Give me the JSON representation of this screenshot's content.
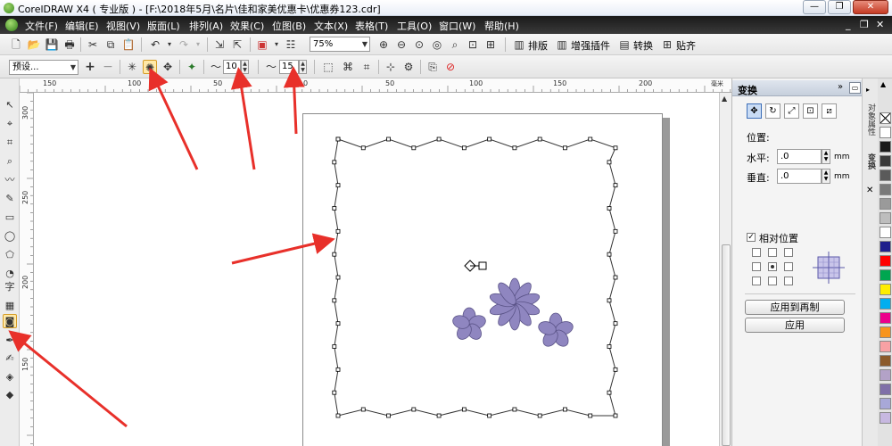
{
  "window": {
    "title": "CorelDRAW X4 ( 专业版 ) - [F:\\2018年5月\\名片\\佳和家美优惠卡\\优惠券123.cdr]",
    "minimize": "—",
    "restore": "❐",
    "close": "✕"
  },
  "menu": {
    "items": [
      "文件(F)",
      "编辑(E)",
      "视图(V)",
      "版面(L)",
      "排列(A)",
      "效果(C)",
      "位图(B)",
      "文本(X)",
      "表格(T)",
      "工具(O)",
      "窗口(W)",
      "帮助(H)"
    ],
    "min": "_",
    "restore": "❐",
    "close": "✕"
  },
  "toolbar": {
    "zoom_value": "75%",
    "layout_label": "排版",
    "plugin_label": "增强插件",
    "convert_label": "转换",
    "paste_label": "贴齐"
  },
  "property_bar": {
    "preset_value": "预设...",
    "frequency_value": "10",
    "amplitude_value": "15"
  },
  "rulers": {
    "h_labels": [
      "150",
      "100",
      "50",
      "0",
      "50",
      "100",
      "150",
      "200"
    ],
    "h_unit": "毫米",
    "v_labels": [
      "300",
      "250",
      "200",
      "150"
    ]
  },
  "docker": {
    "title": "变换",
    "position_label": "位置:",
    "horizontal_label": "水平:",
    "horizontal_value": ".0",
    "vertical_label": "垂直:",
    "vertical_value": ".0",
    "unit": "mm",
    "relative_label": "相对位置",
    "relative_checked": true,
    "apply_duplicate_label": "应用到再制",
    "apply_label": "应用"
  },
  "side_tabs": {
    "object_props": "对象属性",
    "transform": "变换",
    "close": "✕"
  },
  "palette": [
    "#ffffff",
    "#1a1a1a",
    "#3a3a3a",
    "#5a5a5a",
    "#7a7a7a",
    "#9a9a9a",
    "#bdbdbd",
    "#ffffff",
    "#1f1f8c",
    "#ff0000",
    "#00a650",
    "#ffed00",
    "#00aeef",
    "#ec008c",
    "#f7941d",
    "#f8a1a4",
    "#8b5a2b",
    "#b3a2c7",
    "#7f6fa8",
    "#a8a8d8",
    "#c7b8e0"
  ],
  "colors": {
    "flower_fill": "#8f86c0",
    "flower_stroke": "#5a5387",
    "annotation_red": "#e8302a",
    "menubar": "#2a2a2a"
  }
}
